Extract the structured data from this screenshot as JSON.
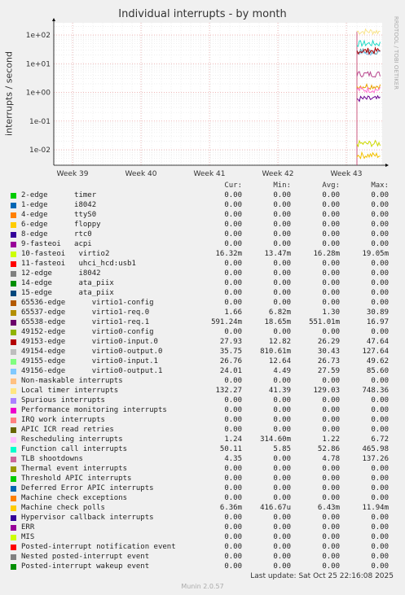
{
  "chart_data": {
    "type": "line",
    "title": "Individual interrupts - by month",
    "ylabel": "interrupts / second",
    "y_scale": "log",
    "y_ticks": [
      "1e+02",
      "1e+01",
      "1e+00",
      "1e-01",
      "1e-02"
    ],
    "x_ticks": [
      "Week 39",
      "Week 40",
      "Week 41",
      "Week 42",
      "Week 43"
    ],
    "grid": true,
    "series": [
      {
        "name": "Local timer interrupts",
        "color": "#f8e38a",
        "level": 132.27
      },
      {
        "name": "Function call interrupts",
        "color": "#20d9c6",
        "level": 50.11
      },
      {
        "name": "49155-edge virtio0-input.1",
        "color": "#5c9fb0",
        "level": 26.76
      },
      {
        "name": "49156-edge virtio0-output.1",
        "color": "#7fc3f0",
        "level": 24.01
      },
      {
        "name": "49153-edge virtio0-input.0",
        "color": "#b40000",
        "level": 27.93
      },
      {
        "name": "TLB shootdowns",
        "color": "#b8468e",
        "level": 4.35
      },
      {
        "name": "65537-edge virtio1-req.0",
        "color": "#e8a000",
        "level": 1.66
      },
      {
        "name": "Rescheduling interrupts",
        "color": "#ff6fd0",
        "level": 1.24
      },
      {
        "name": "65538-edge virtio1-req.1",
        "color": "#6a0090",
        "level": 0.59124
      },
      {
        "name": "10-fasteoi virtio2",
        "color": "#ccd800",
        "level": 0.01632
      },
      {
        "name": "Machine check polls",
        "color": "#f4c200",
        "level": 0.00636
      }
    ]
  },
  "legend_header": {
    "cur": "Cur:",
    "min": "Min:",
    "avg": "Avg:",
    "max": "Max:"
  },
  "legend": [
    {
      "label": "2-edge      timer",
      "color": "#00cc00",
      "cur": "0.00",
      "min": "0.00",
      "avg": "0.00",
      "max": "0.00"
    },
    {
      "label": "1-edge      i8042",
      "color": "#0066b3",
      "cur": "0.00",
      "min": "0.00",
      "avg": "0.00",
      "max": "0.00"
    },
    {
      "label": "4-edge      ttyS0",
      "color": "#ff8000",
      "cur": "0.00",
      "min": "0.00",
      "avg": "0.00",
      "max": "0.00"
    },
    {
      "label": "6-edge      floppy",
      "color": "#ffcc00",
      "cur": "0.00",
      "min": "0.00",
      "avg": "0.00",
      "max": "0.00"
    },
    {
      "label": "8-edge      rtc0",
      "color": "#330099",
      "cur": "0.00",
      "min": "0.00",
      "avg": "0.00",
      "max": "0.00"
    },
    {
      "label": "9-fasteoi   acpi",
      "color": "#990099",
      "cur": "0.00",
      "min": "0.00",
      "avg": "0.00",
      "max": "0.00"
    },
    {
      "label": "10-fasteoi   virtio2",
      "color": "#ccff00",
      "cur": "16.32m",
      "min": "13.47m",
      "avg": "16.28m",
      "max": "19.05m"
    },
    {
      "label": "11-fasteoi   uhci_hcd:usb1",
      "color": "#ff0000",
      "cur": "0.00",
      "min": "0.00",
      "avg": "0.00",
      "max": "0.00"
    },
    {
      "label": "12-edge      i8042",
      "color": "#808080",
      "cur": "0.00",
      "min": "0.00",
      "avg": "0.00",
      "max": "0.00"
    },
    {
      "label": "14-edge      ata_piix",
      "color": "#008f00",
      "cur": "0.00",
      "min": "0.00",
      "avg": "0.00",
      "max": "0.00"
    },
    {
      "label": "15-edge      ata_piix",
      "color": "#00487d",
      "cur": "0.00",
      "min": "0.00",
      "avg": "0.00",
      "max": "0.00"
    },
    {
      "label": "65536-edge      virtio1-config",
      "color": "#b35a00",
      "cur": "0.00",
      "min": "0.00",
      "avg": "0.00",
      "max": "0.00"
    },
    {
      "label": "65537-edge      virtio1-req.0",
      "color": "#b38f00",
      "cur": "1.66",
      "min": "6.82m",
      "avg": "1.30",
      "max": "30.89"
    },
    {
      "label": "65538-edge      virtio1-req.1",
      "color": "#6b006b",
      "cur": "591.24m",
      "min": "18.65m",
      "avg": "551.01m",
      "max": "16.97"
    },
    {
      "label": "49152-edge      virtio0-config",
      "color": "#8fb300",
      "cur": "0.00",
      "min": "0.00",
      "avg": "0.00",
      "max": "0.00"
    },
    {
      "label": "49153-edge      virtio0-input.0",
      "color": "#b30000",
      "cur": "27.93",
      "min": "12.82",
      "avg": "26.29",
      "max": "47.64"
    },
    {
      "label": "49154-edge      virtio0-output.0",
      "color": "#bebebe",
      "cur": "35.75",
      "min": "810.61m",
      "avg": "30.43",
      "max": "127.64"
    },
    {
      "label": "49155-edge      virtio0-input.1",
      "color": "#80ff80",
      "cur": "26.76",
      "min": "12.64",
      "avg": "26.73",
      "max": "49.62"
    },
    {
      "label": "49156-edge      virtio0-output.1",
      "color": "#80c9ff",
      "cur": "24.01",
      "min": "4.49",
      "avg": "27.59",
      "max": "85.60"
    },
    {
      "label": "Non-maskable interrupts",
      "color": "#ffc080",
      "cur": "0.00",
      "min": "0.00",
      "avg": "0.00",
      "max": "0.00"
    },
    {
      "label": "Local timer interrupts",
      "color": "#ffe680",
      "cur": "132.27",
      "min": "41.39",
      "avg": "129.03",
      "max": "748.36"
    },
    {
      "label": "Spurious interrupts",
      "color": "#aa80ff",
      "cur": "0.00",
      "min": "0.00",
      "avg": "0.00",
      "max": "0.00"
    },
    {
      "label": "Performance monitoring interrupts",
      "color": "#ee00cc",
      "cur": "0.00",
      "min": "0.00",
      "avg": "0.00",
      "max": "0.00"
    },
    {
      "label": "IRQ work interrupts",
      "color": "#ff8080",
      "cur": "0.00",
      "min": "0.00",
      "avg": "0.00",
      "max": "0.00"
    },
    {
      "label": "APIC ICR read retries",
      "color": "#666600",
      "cur": "0.00",
      "min": "0.00",
      "avg": "0.00",
      "max": "0.00"
    },
    {
      "label": "Rescheduling interrupts",
      "color": "#ffbfff",
      "cur": "1.24",
      "min": "314.60m",
      "avg": "1.22",
      "max": "6.72"
    },
    {
      "label": "Function call interrupts",
      "color": "#00ffcc",
      "cur": "50.11",
      "min": "5.85",
      "avg": "52.86",
      "max": "465.98"
    },
    {
      "label": "TLB shootdowns",
      "color": "#cc6699",
      "cur": "4.35",
      "min": "0.00",
      "avg": "4.78",
      "max": "137.26"
    },
    {
      "label": "Thermal event interrupts",
      "color": "#999900",
      "cur": "0.00",
      "min": "0.00",
      "avg": "0.00",
      "max": "0.00"
    },
    {
      "label": "Threshold APIC interrupts",
      "color": "#00cc00",
      "cur": "0.00",
      "min": "0.00",
      "avg": "0.00",
      "max": "0.00"
    },
    {
      "label": "Deferred Error APIC interrupts",
      "color": "#0066b3",
      "cur": "0.00",
      "min": "0.00",
      "avg": "0.00",
      "max": "0.00"
    },
    {
      "label": "Machine check exceptions",
      "color": "#ff8000",
      "cur": "0.00",
      "min": "0.00",
      "avg": "0.00",
      "max": "0.00"
    },
    {
      "label": "Machine check polls",
      "color": "#ffcc00",
      "cur": "6.36m",
      "min": "416.67u",
      "avg": "6.43m",
      "max": "11.94m"
    },
    {
      "label": "Hypervisor callback interrupts",
      "color": "#330099",
      "cur": "0.00",
      "min": "0.00",
      "avg": "0.00",
      "max": "0.00"
    },
    {
      "label": "ERR",
      "color": "#990099",
      "cur": "0.00",
      "min": "0.00",
      "avg": "0.00",
      "max": "0.00"
    },
    {
      "label": "MIS",
      "color": "#ccff00",
      "cur": "0.00",
      "min": "0.00",
      "avg": "0.00",
      "max": "0.00"
    },
    {
      "label": "Posted-interrupt notification event",
      "color": "#ff0000",
      "cur": "0.00",
      "min": "0.00",
      "avg": "0.00",
      "max": "0.00"
    },
    {
      "label": "Nested posted-interrupt event",
      "color": "#808080",
      "cur": "0.00",
      "min": "0.00",
      "avg": "0.00",
      "max": "0.00"
    },
    {
      "label": "Posted-interrupt wakeup event",
      "color": "#008f00",
      "cur": "0.00",
      "min": "0.00",
      "avg": "0.00",
      "max": "0.00"
    }
  ],
  "side_text": "RRDTOOL / TOBI OETIKER",
  "footer": "Last update: Sat Oct 25 22:16:08 2025",
  "munin_version": "Munin 2.0.57"
}
